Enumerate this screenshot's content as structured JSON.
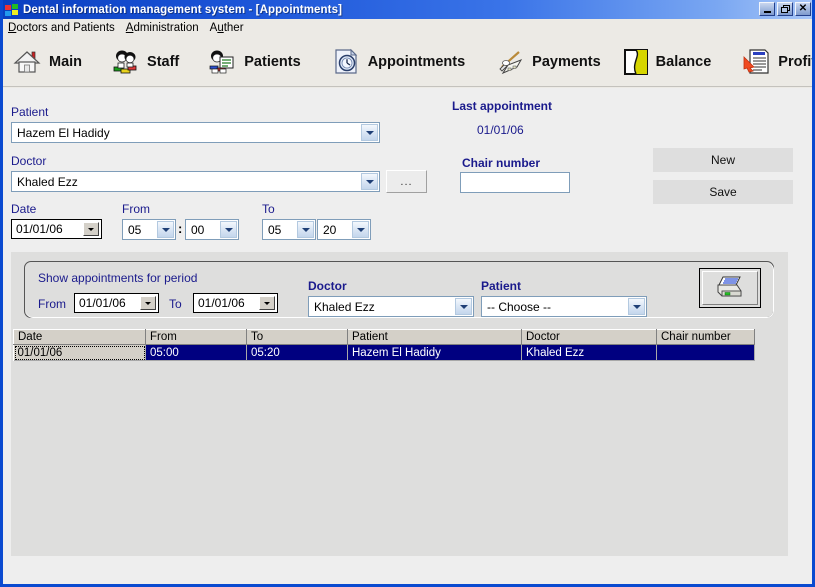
{
  "window": {
    "title": "Dental information management system - [Appointments]",
    "icon": "windows-logo-icon",
    "buttons": {
      "minimize": "_",
      "restore": "❐",
      "close": "✕"
    }
  },
  "menubar": {
    "items": [
      {
        "label": "Doctors and Patients",
        "accel": "D"
      },
      {
        "label": "Administration",
        "accel": "A"
      },
      {
        "label": "Auther",
        "accel": "u"
      }
    ]
  },
  "toolbar": {
    "items": [
      {
        "label": "Main",
        "icon": "house-icon"
      },
      {
        "label": "Staff",
        "icon": "staff-people-icon"
      },
      {
        "label": "Patients",
        "icon": "patient-record-icon"
      },
      {
        "label": "Appointments",
        "icon": "appointment-clock-page-icon"
      },
      {
        "label": "Payments",
        "icon": "payments-cash-icon"
      },
      {
        "label": "Balance",
        "icon": "balance-yellow-icon"
      },
      {
        "label": "Profit",
        "icon": "profit-chart-icon"
      }
    ],
    "more_label": ">>>"
  },
  "form": {
    "patient_label": "Patient",
    "patient_value": "Hazem El Hadidy",
    "doctor_label": "Doctor",
    "doctor_value": "Khaled Ezz",
    "browse_button": "...",
    "date_label": "Date",
    "date_value": "01/01/06",
    "from_label": "From",
    "from_hour": "05",
    "from_minute": "00",
    "to_label": "To",
    "to_hour": "05",
    "to_minute": "20",
    "colon": ":",
    "last_appointment_label": "Last appointment",
    "last_appointment_value": "01/01/06",
    "chair_number_label": "Chair number",
    "chair_number_value": "",
    "new_button": "New",
    "save_button": "Save"
  },
  "period_panel": {
    "title": "Show appointments for period",
    "from_label": "From",
    "from_value": "01/01/06",
    "to_label": "To",
    "to_value": "01/01/06",
    "doctor_label": "Doctor",
    "doctor_value": "Khaled Ezz",
    "patient_label": "Patient",
    "patient_value": "-- Choose --",
    "print_button": "printer-icon"
  },
  "grid": {
    "columns": [
      "Date",
      "From",
      "To",
      "Patient",
      "Doctor",
      "Chair number"
    ],
    "rows": [
      {
        "Date": "01/01/06",
        "From": "05:00",
        "To": "05:20",
        "Patient": "Hazem El Hadidy",
        "Doctor": "Khaled Ezz",
        "Chair number": ""
      }
    ]
  },
  "colors": {
    "title_bar_start": "#0a3fc0",
    "title_bar_end": "#a9c7f8",
    "label_blue": "#1a1a8c",
    "selection_navy": "#000080",
    "panel_gray": "#dededd",
    "client_gray": "#eeeeee",
    "combo_border": "#7f9db9"
  }
}
